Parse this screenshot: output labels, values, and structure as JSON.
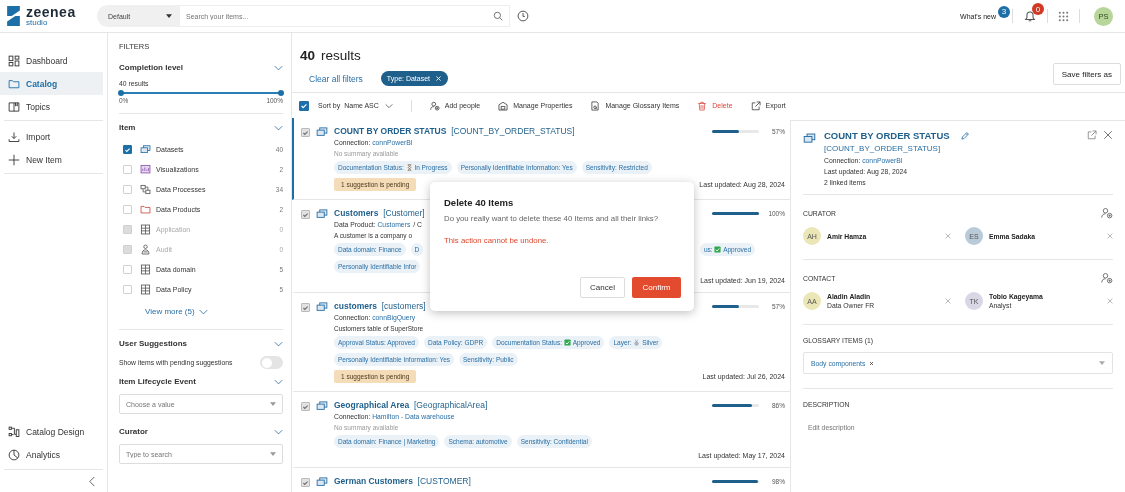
{
  "topbar": {
    "logo": "zeenea",
    "logo_sub": "studio",
    "scope": "Default",
    "search_placeholder": "Search your items...",
    "whats_new": "What's new",
    "whats_new_count": "3",
    "notification_count": "0",
    "avatar": "PS"
  },
  "nav": {
    "groups": [
      {
        "items": [
          {
            "label": "Dashboard",
            "selected": false
          },
          {
            "label": "Catalog",
            "selected": true
          },
          {
            "label": "Topics",
            "selected": false
          }
        ]
      },
      {
        "items": [
          {
            "label": "Import",
            "selected": false
          },
          {
            "label": "New Item",
            "selected": false
          }
        ]
      }
    ],
    "bottom": [
      {
        "label": "Catalog Design",
        "selected": false
      },
      {
        "label": "Analytics",
        "selected": false
      }
    ]
  },
  "filters": {
    "title": "FILTERS",
    "sections": [
      {
        "kind": "range",
        "title": "Completion level",
        "summary": "40 results",
        "level": 1,
        "min_label": "0%",
        "max_label": "100%"
      },
      {
        "kind": "checklist",
        "title": "Item",
        "more": "View more (5)",
        "options": [
          {
            "label": "Datasets",
            "count": "40",
            "checked": true,
            "disabled": false
          },
          {
            "label": "Visualizations",
            "count": "2",
            "checked": false,
            "disabled": false
          },
          {
            "label": "Data Processes",
            "count": "34",
            "checked": false,
            "disabled": false
          },
          {
            "label": "Data Products",
            "count": "2",
            "checked": false,
            "disabled": false
          },
          {
            "label": "Application",
            "count": "0",
            "checked": false,
            "disabled": true
          },
          {
            "label": "Audit",
            "count": "0",
            "checked": false,
            "disabled": true
          },
          {
            "label": "Data domain",
            "count": "5",
            "checked": false,
            "disabled": false
          },
          {
            "label": "Data Policy",
            "count": "5",
            "checked": false,
            "disabled": false
          }
        ]
      },
      {
        "kind": "toggle",
        "title": "User Suggestions",
        "label": "Show items with pending suggestions",
        "on": false
      },
      {
        "kind": "select",
        "title": "Item Lifecycle Event",
        "placeholder": "Choose a value"
      },
      {
        "kind": "select",
        "title": "Curator",
        "placeholder": "Type to search"
      }
    ]
  },
  "results": {
    "count": "40",
    "label": "results",
    "clear": "Clear all filters",
    "chips": [
      "Type: Dataset"
    ],
    "save": "Save filters as",
    "select_all": true,
    "sort_label": "Sort by",
    "sort_value": "Name ASC",
    "actions": [
      {
        "label": "Add people",
        "danger": false
      },
      {
        "label": "Manage Properties",
        "danger": false
      },
      {
        "label": "Manage Glossary Items",
        "danger": false
      },
      {
        "label": "Delete",
        "danger": true
      },
      {
        "label": "Export",
        "danger": false
      }
    ],
    "rows": [
      {
        "title": "COUNT BY ORDER STATUS",
        "code": "[COUNT_BY_ORDER_STATUS]",
        "selected": true,
        "checked": true,
        "meta": {
          "label": "Connection:",
          "link": "connPowerBI"
        },
        "summary": "No summary available",
        "summary_muted": true,
        "tag_rows": [
          [
            {
              "label": "Documentation Status:",
              "kind": "hourglass",
              "value": "In Progress"
            },
            {
              "label": "Personally Identifiable Information: Yes"
            },
            {
              "label": "Sensitivity: Restricted"
            }
          ]
        ],
        "suggestion": "1 suggestion is pending",
        "updated": "Last updated: Aug 28, 2024",
        "level": 0.57,
        "percent": "57%"
      },
      {
        "title": "Customers",
        "code": "[Customer]",
        "selected": false,
        "checked": true,
        "meta": {
          "label": "Data Product:",
          "link": "Customers",
          "suffix": "/ C"
        },
        "summary": "A customer is a company o",
        "summary_muted": false,
        "tag_rows": [
          [
            {
              "label": "Data domain: Finance"
            },
            {
              "label": "D"
            },
            {
              "label": "us:",
              "kind": "check",
              "value": "Approved",
              "after_dialog": true
            }
          ],
          [
            {
              "label": "Personally Identifiable Infor"
            }
          ]
        ],
        "updated": "Last updated: Jun 19, 2024",
        "level": 1,
        "percent": "100%"
      },
      {
        "title": "customers",
        "code": "[customers]",
        "selected": false,
        "checked": true,
        "meta": {
          "label": "Connection:",
          "link": "connBigQuery"
        },
        "summary": "Customers table of SuperStore",
        "summary_muted": false,
        "tag_rows": [
          [
            {
              "label": "Approval Status: Approved"
            },
            {
              "label": "Data Policy: GDPR"
            },
            {
              "label": "Documentation Status:",
              "kind": "check",
              "value": "Approved"
            },
            {
              "label": "Layer:",
              "kind": "medal",
              "value": "Silver"
            }
          ],
          [
            {
              "label": "Personally Identifiable Information: Yes"
            },
            {
              "label": "Sensitivity: Public"
            }
          ]
        ],
        "suggestion": "1 suggestion is pending",
        "updated": "Last updated: Jul 26, 2024",
        "level": 0.57,
        "percent": "57%"
      },
      {
        "title": "Geographical Area",
        "code": "[GeographicalArea]",
        "selected": false,
        "checked": true,
        "meta": {
          "label": "Connection:",
          "link": "Hamilton - Data warehouse"
        },
        "summary": "No summary available",
        "summary_muted": true,
        "tag_rows": [
          [
            {
              "label": "Data domain:  Finance  |  Marketing"
            },
            {
              "label": "Schema: automotive"
            },
            {
              "label": "Sensitivity: Confidential"
            }
          ]
        ],
        "updated": "Last updated: May 17, 2024",
        "level": 0.86,
        "percent": "86%"
      },
      {
        "title": "German Customers",
        "code": "[CUSTOMER]",
        "selected": false,
        "checked": true,
        "level": 0.98,
        "percent": "98%"
      }
    ]
  },
  "detail": {
    "title": "COUNT BY ORDER STATUS",
    "code": "[COUNT_BY_ORDER_STATUS]",
    "connection_label": "Connection:",
    "connection": "connPowerBI",
    "updated": "Last updated: Aug 28, 2024",
    "linked": "2 linked items",
    "curator": {
      "title": "CURATOR",
      "people": [
        {
          "initials": "AH",
          "name": "Amir Hamza",
          "color": "#ebe6b5"
        },
        {
          "initials": "ES",
          "name": "Emma Sadaka",
          "color": "#b9cad9"
        }
      ]
    },
    "contact": {
      "title": "CONTACT",
      "people": [
        {
          "initials": "AA",
          "name": "Aladin Aladin",
          "role": "Data Owner FR",
          "color": "#ebe6b5"
        },
        {
          "initials": "TK",
          "name": "Tobio Kageyama",
          "role": "Analyst",
          "color": "#d9d6e6"
        }
      ]
    },
    "glossary": {
      "title": "GLOSSARY ITEMS (1)",
      "chips": [
        "Body components"
      ]
    },
    "description": {
      "title": "DESCRIPTION",
      "placeholder": "Edit description"
    }
  },
  "dialog": {
    "title": "Delete 40 Items",
    "message": "Do you really want to delete these 40 Items and all their links?",
    "warning": "This action cannot be undone.",
    "cancel": "Cancel",
    "confirm": "Confirm"
  }
}
